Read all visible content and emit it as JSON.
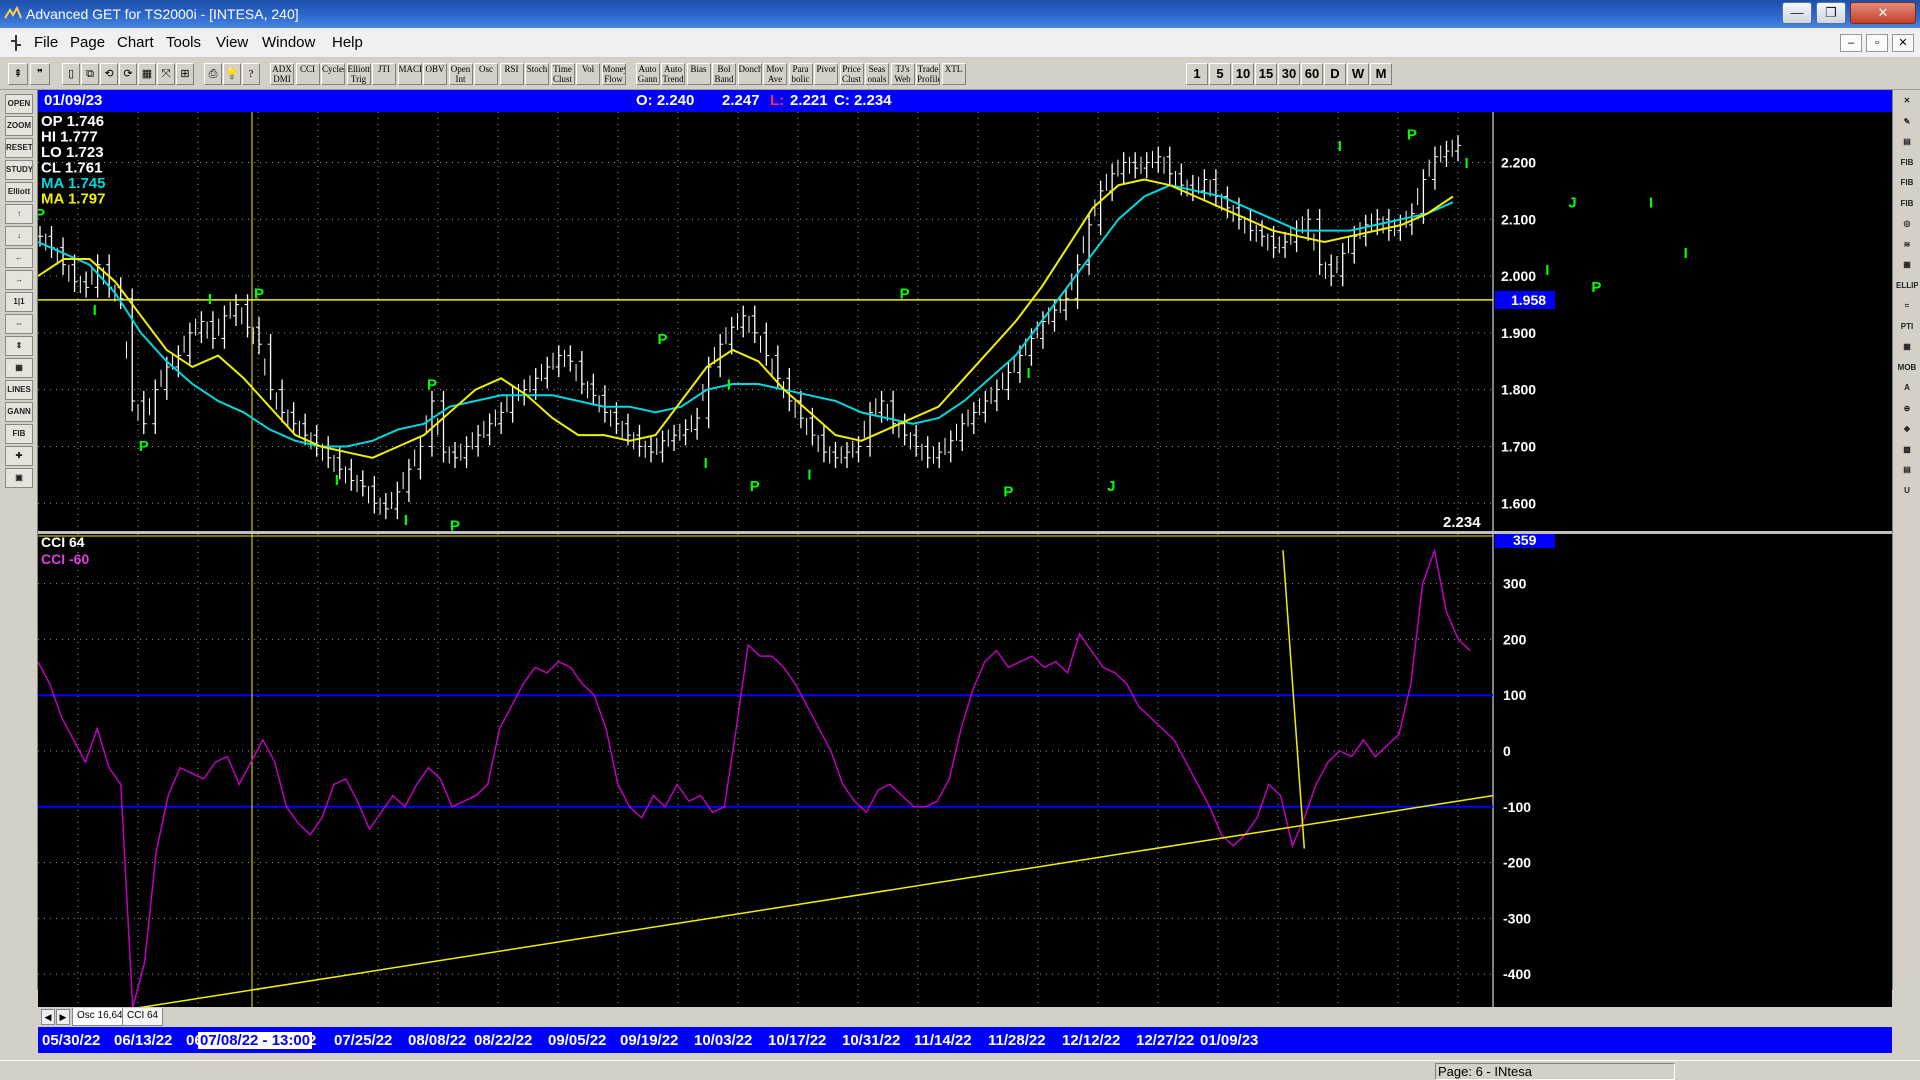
{
  "window": {
    "title": "Advanced GET for TS2000i - [INTESA, 240]",
    "minimize": "—",
    "maximize": "❐",
    "close": "✕"
  },
  "menu": {
    "file": "File",
    "page": "Page",
    "chart": "Chart",
    "tools": "Tools",
    "view": "View",
    "window": "Window",
    "help": "Help"
  },
  "mdi": {
    "min": "–",
    "restore": "▫",
    "close": "✕"
  },
  "toolbar": {
    "studies": [
      "ADX DMI",
      "CCI",
      "Cycles",
      "Elliott Trig",
      "JTI",
      "MACD",
      "OBV",
      "Open Int",
      "Osc",
      "RSI",
      "Stoch",
      "Time Clust",
      "Vol",
      "Money Flow",
      "Auto Gann",
      "Auto Trend",
      "Bias",
      "Bol Band",
      "Donch",
      "Mov Ave",
      "Para bolic",
      "Pivot",
      "Price Clust",
      "Seas onals",
      "TJ's Web",
      "Trade Profile",
      "XTL"
    ],
    "intervals": [
      "1",
      "5",
      "10",
      "15",
      "30",
      "60",
      "D",
      "W",
      "M"
    ]
  },
  "lefttools": [
    "OPEN",
    "ZOOM",
    "RESET",
    "STUDY",
    "Elliott",
    "↑",
    "↓",
    "←",
    "→",
    "1|1",
    "⇔",
    "⇕",
    "▦",
    "LINES",
    "GANN",
    "FIB",
    "✚",
    "▣"
  ],
  "righttools": [
    "✕",
    "✎",
    "▤",
    "FIB RET",
    "FIB EXT",
    "FIB TIME",
    "◎",
    "≋",
    "▦",
    "ELLIPS",
    "≈",
    "PTI",
    "▦",
    "MOB",
    "A",
    "⊕",
    "◈",
    "▩",
    "▤",
    "U"
  ],
  "infobar": {
    "date": "01/09/23",
    "open": "O: 2.240",
    "high": "2.247",
    "low_label": "L:",
    "low": "2.221",
    "close": "C: 2.234"
  },
  "readout": {
    "op": "OP 1.746",
    "hi": "HI  1.777",
    "lo": "LO  1.723",
    "cl": "CL  1.761",
    "ma1": "MA  1.745",
    "ma2": "MA  1.797"
  },
  "price_axis": {
    "labels": [
      "2.200",
      "2.100",
      "2.000",
      "1.900",
      "1.800",
      "1.700",
      "1.600"
    ],
    "values": [
      2.2,
      2.1,
      2.0,
      1.9,
      1.8,
      1.7,
      1.6
    ],
    "highlight": "1.958",
    "highlight_value": 1.958,
    "last": "2.234"
  },
  "osc_axis": {
    "labels": [
      "300",
      "200",
      "100",
      "0",
      "-100",
      "-200",
      "-300",
      "-400"
    ],
    "values": [
      300,
      200,
      100,
      0,
      -100,
      -200,
      -300,
      -400
    ],
    "highlight": "359"
  },
  "osc_legend": {
    "name": "CCI 64",
    "value": "CCI  -60"
  },
  "tabs": [
    "Osc 16,64",
    "CCI 64"
  ],
  "dates": [
    "05/30/22",
    "06/13/22",
    "06",
    "07/08/22 - 13:00",
    "2",
    "07/25/22",
    "08/08/22",
    "08/22/22",
    "09/05/22",
    "09/19/22",
    "10/03/22",
    "10/17/22",
    "10/31/22",
    "11/14/22",
    "11/28/22",
    "12/12/22",
    "12/27/22",
    "01/09/23"
  ],
  "status": {
    "page": "Page: 6 - INtesa"
  },
  "colors": {
    "bg": "#000000",
    "bars": "#ffffff",
    "ma_fast": "#00d8e0",
    "ma_slow": "#f0f000",
    "cci": "#c000c0",
    "labels": "#00ff00",
    "level": "#0000ff",
    "grid": "#9a9a9a"
  },
  "chart_data": {
    "type": "line",
    "title": "INTESA, 240",
    "price_ylim": [
      1.56,
      2.28
    ],
    "price_series": [
      {
        "name": "price",
        "values": [
          2.07,
          2.05,
          2.02,
          1.99,
          1.98,
          2.02,
          1.98,
          1.96,
          1.78,
          1.74,
          1.8,
          1.84,
          1.86,
          1.9,
          1.92,
          1.89,
          1.93,
          1.95,
          1.91,
          1.88,
          1.8,
          1.76,
          1.74,
          1.72,
          1.7,
          1.68,
          1.66,
          1.64,
          1.63,
          1.6,
          1.59,
          1.62,
          1.66,
          1.7,
          1.78,
          1.69,
          1.68,
          1.7,
          1.72,
          1.74,
          1.76,
          1.79,
          1.8,
          1.82,
          1.84,
          1.86,
          1.85,
          1.81,
          1.79,
          1.76,
          1.74,
          1.72,
          1.7,
          1.69,
          1.71,
          1.72,
          1.73,
          1.75,
          1.84,
          1.88,
          1.91,
          1.93,
          1.9,
          1.86,
          1.82,
          1.78,
          1.75,
          1.72,
          1.69,
          1.68,
          1.69,
          1.7,
          1.76,
          1.78,
          1.74,
          1.72,
          1.7,
          1.68,
          1.69,
          1.71,
          1.74,
          1.76,
          1.78,
          1.8,
          1.83,
          1.86,
          1.89,
          1.92,
          1.94,
          1.96,
          2.02,
          2.09,
          2.15,
          2.18,
          2.2,
          2.19,
          2.2,
          2.21,
          2.18,
          2.16,
          2.15,
          2.17,
          2.14,
          2.12,
          2.1,
          2.08,
          2.07,
          2.05,
          2.06,
          2.08,
          2.1,
          2.02,
          2.0,
          2.04,
          2.07,
          2.09,
          2.1,
          2.08,
          2.09,
          2.11,
          2.17,
          2.21,
          2.22,
          2.23
        ]
      },
      {
        "name": "MA fast",
        "values": [
          2.06,
          2.04,
          2.02,
          1.97,
          1.9,
          1.85,
          1.81,
          1.78,
          1.76,
          1.73,
          1.71,
          1.7,
          1.7,
          1.71,
          1.73,
          1.74,
          1.77,
          1.78,
          1.79,
          1.79,
          1.79,
          1.78,
          1.77,
          1.77,
          1.76,
          1.77,
          1.8,
          1.81,
          1.81,
          1.8,
          1.79,
          1.78,
          1.76,
          1.75,
          1.74,
          1.75,
          1.78,
          1.82,
          1.86,
          1.92,
          1.98,
          2.04,
          2.1,
          2.14,
          2.16,
          2.15,
          2.14,
          2.12,
          2.1,
          2.08,
          2.08,
          2.08,
          2.09,
          2.1,
          2.11,
          2.13
        ]
      },
      {
        "name": "MA slow",
        "values": [
          2.0,
          2.03,
          2.03,
          1.99,
          1.93,
          1.87,
          1.84,
          1.86,
          1.82,
          1.77,
          1.72,
          1.7,
          1.69,
          1.68,
          1.7,
          1.72,
          1.76,
          1.8,
          1.82,
          1.79,
          1.75,
          1.72,
          1.72,
          1.71,
          1.72,
          1.78,
          1.84,
          1.87,
          1.85,
          1.8,
          1.76,
          1.72,
          1.71,
          1.73,
          1.75,
          1.77,
          1.82,
          1.87,
          1.92,
          1.98,
          2.05,
          2.12,
          2.16,
          2.17,
          2.16,
          2.14,
          2.12,
          2.1,
          2.08,
          2.07,
          2.06,
          2.07,
          2.08,
          2.09,
          2.11,
          2.14
        ]
      }
    ],
    "pivot_labels": [
      {
        "label": "P",
        "idx": 0,
        "price": 2.09,
        "pos": "above"
      },
      {
        "label": "I",
        "idx": 5,
        "price": 1.96,
        "pos": "below"
      },
      {
        "label": "P",
        "idx": 9,
        "price": 1.72,
        "pos": "below"
      },
      {
        "label": "I",
        "idx": 15,
        "price": 1.94,
        "pos": "above"
      },
      {
        "label": "P",
        "idx": 19,
        "price": 1.95,
        "pos": "above"
      },
      {
        "label": "I",
        "idx": 26,
        "price": 1.66,
        "pos": "below"
      },
      {
        "label": "P",
        "idx": 34,
        "price": 1.79,
        "pos": "above"
      },
      {
        "label": "I",
        "idx": 32,
        "price": 1.59,
        "pos": "below"
      },
      {
        "label": "P",
        "idx": 36,
        "price": 1.58,
        "pos": "below"
      },
      {
        "label": "P",
        "idx": 54,
        "price": 1.87,
        "pos": "above"
      },
      {
        "label": "I",
        "idx": 58,
        "price": 1.69,
        "pos": "below"
      },
      {
        "label": "P",
        "idx": 62,
        "price": 1.65,
        "pos": "below"
      },
      {
        "label": "I",
        "idx": 60,
        "price": 1.79,
        "pos": "above"
      },
      {
        "label": "I",
        "idx": 67,
        "price": 1.67,
        "pos": "below"
      },
      {
        "label": "P",
        "idx": 75,
        "price": 1.95,
        "pos": "above"
      },
      {
        "label": "P",
        "idx": 84,
        "price": 1.64,
        "pos": "below"
      },
      {
        "label": "I",
        "idx": 86,
        "price": 1.81,
        "pos": "above"
      },
      {
        "label": "J",
        "idx": 93,
        "price": 1.65,
        "pos": "below"
      },
      {
        "label": "I",
        "idx": 113,
        "price": 2.21,
        "pos": "above"
      },
      {
        "label": "P",
        "idx": 119,
        "price": 2.23,
        "pos": "above"
      },
      {
        "label": "I",
        "idx": 124,
        "price": 2.18,
        "pos": "above"
      },
      {
        "label": "I",
        "idx": 131,
        "price": 2.03,
        "pos": "below"
      },
      {
        "label": "J",
        "idx": 133,
        "price": 2.11,
        "pos": "above"
      },
      {
        "label": "P",
        "idx": 135,
        "price": 2.0,
        "pos": "below"
      },
      {
        "label": "I",
        "idx": 140,
        "price": 2.11,
        "pos": "above"
      },
      {
        "label": "I",
        "idx": 143,
        "price": 2.06,
        "pos": "below"
      }
    ],
    "cci_ylim": [
      -450,
      380
    ],
    "cci_series": {
      "name": "CCI 64",
      "values": [
        160,
        120,
        60,
        20,
        -20,
        40,
        -30,
        -60,
        -460,
        -380,
        -180,
        -80,
        -30,
        -40,
        -50,
        -20,
        -10,
        -60,
        -20,
        20,
        -20,
        -100,
        -130,
        -150,
        -120,
        -60,
        -50,
        -90,
        -140,
        -110,
        -80,
        -100,
        -60,
        -30,
        -50,
        -100,
        -90,
        -80,
        -60,
        40,
        80,
        120,
        150,
        140,
        160,
        150,
        120,
        100,
        40,
        -60,
        -100,
        -120,
        -80,
        -100,
        -60,
        -90,
        -80,
        -110,
        -100,
        40,
        190,
        170,
        170,
        150,
        120,
        80,
        40,
        0,
        -60,
        -90,
        -110,
        -70,
        -60,
        -80,
        -100,
        -100,
        -90,
        -50,
        40,
        110,
        160,
        180,
        150,
        160,
        170,
        150,
        160,
        140,
        210,
        180,
        150,
        140,
        120,
        80,
        60,
        40,
        20,
        -20,
        -60,
        -100,
        -150,
        -170,
        -150,
        -120,
        -60,
        -80,
        -170,
        -120,
        -60,
        -20,
        0,
        -10,
        20,
        -10,
        10,
        30,
        120,
        300,
        359,
        250,
        200,
        180
      ]
    },
    "horizontal_line": 1.958,
    "crosshair_time": "07/08/22 - 13:00"
  }
}
